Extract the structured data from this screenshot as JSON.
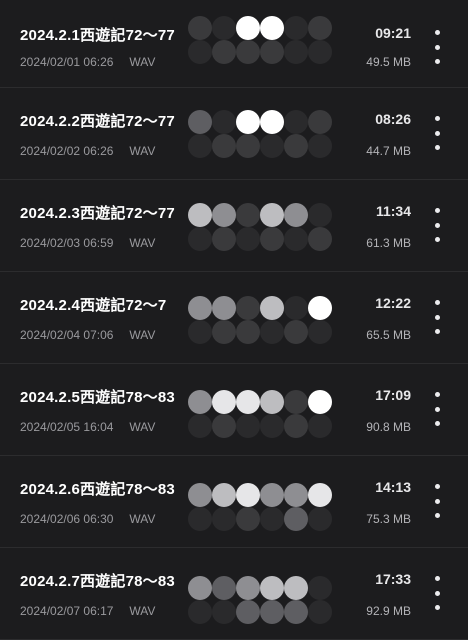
{
  "recordings": [
    {
      "title": "2024.2.1西遊記72〜77",
      "date": "2024/02/01 06:26",
      "format": "WAV",
      "duration": "09:21",
      "size": "49.5 MB"
    },
    {
      "title": "2024.2.2西遊記72〜77",
      "date": "2024/02/02 06:26",
      "format": "WAV",
      "duration": "08:26",
      "size": "44.7 MB"
    },
    {
      "title": "2024.2.3西遊記72〜77",
      "date": "2024/02/03 06:59",
      "format": "WAV",
      "duration": "11:34",
      "size": "61.3 MB"
    },
    {
      "title": "2024.2.4西遊記72〜7",
      "date": "2024/02/04 07:06",
      "format": "WAV",
      "duration": "12:22",
      "size": "65.5 MB"
    },
    {
      "title": "2024.2.5西遊記78〜83",
      "date": "2024/02/05 16:04",
      "format": "WAV",
      "duration": "17:09",
      "size": "90.8 MB"
    },
    {
      "title": "2024.2.6西遊記78〜83",
      "date": "2024/02/06 06:30",
      "format": "WAV",
      "duration": "14:13",
      "size": "75.3 MB"
    },
    {
      "title": "2024.2.7西遊記78〜83",
      "date": "2024/02/07 06:17",
      "format": "WAV",
      "duration": "17:33",
      "size": "92.9 MB"
    }
  ],
  "icons": {
    "more": "more-vertical-icon"
  },
  "colors": {
    "background": "#1c1c1e",
    "title_text": "#ffffff",
    "meta_text": "#9a9a9e",
    "divider": "#2c2c2e"
  }
}
